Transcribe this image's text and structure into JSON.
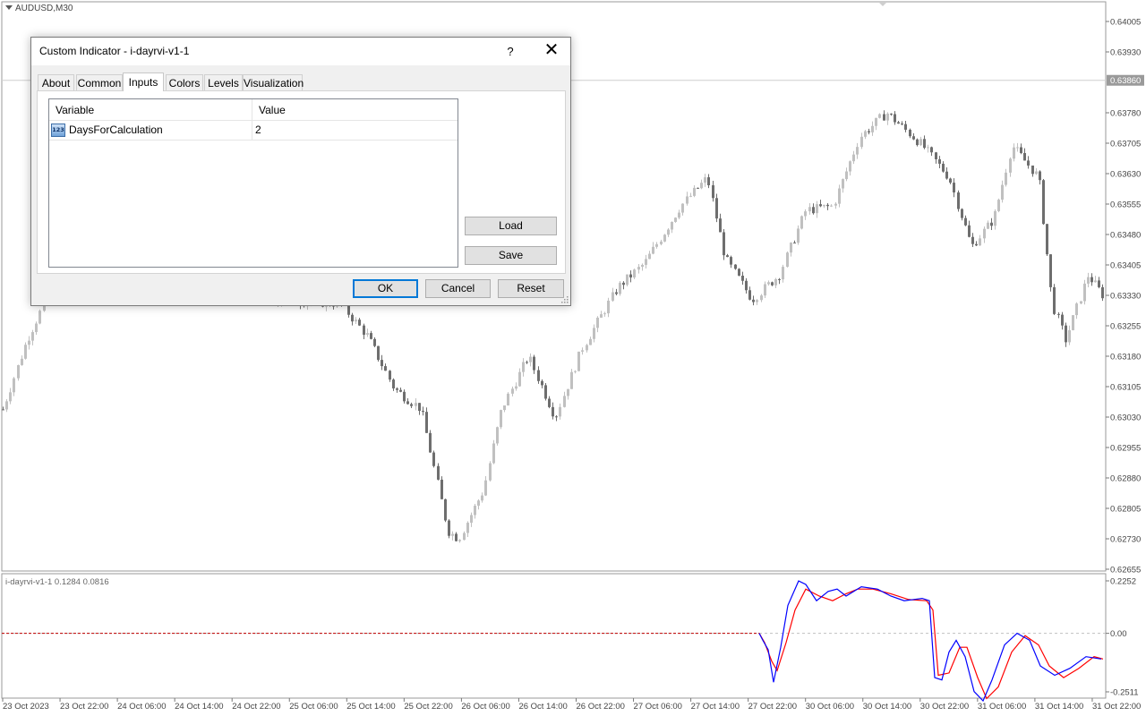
{
  "chart": {
    "symbol": "AUDUSD,M30",
    "current_price": "0.63860",
    "price_ticks": [
      "0.64005",
      "0.63930",
      "0.63780",
      "0.63705",
      "0.63630",
      "0.63555",
      "0.63480",
      "0.63405",
      "0.63330",
      "0.63255",
      "0.63180",
      "0.63105",
      "0.63030",
      "0.62955",
      "0.62880",
      "0.62805",
      "0.62730",
      "0.62655"
    ],
    "time_labels": [
      "23 Oct 2023",
      "23 Oct 22:00",
      "24 Oct 06:00",
      "24 Oct 14:00",
      "24 Oct 22:00",
      "25 Oct 06:00",
      "25 Oct 14:00",
      "25 Oct 22:00",
      "26 Oct 06:00",
      "26 Oct 14:00",
      "26 Oct 22:00",
      "27 Oct 06:00",
      "27 Oct 14:00",
      "27 Oct 22:00",
      "30 Oct 06:00",
      "30 Oct 14:00",
      "30 Oct 22:00",
      "31 Oct 06:00",
      "31 Oct 14:00",
      "31 Oct 22:00"
    ],
    "colors": {
      "bull": "#c0c0c0",
      "bear": "#6e6e6e",
      "line_blue": "#0000ff",
      "line_red": "#ff0000",
      "level": "#c00000"
    }
  },
  "indicator": {
    "label": "i-dayrvi-v1-1 0.1284 0.0816",
    "ticks": [
      "0.2252",
      "0.00",
      "-0.2511"
    ]
  },
  "dialog": {
    "title": "Custom Indicator - i-dayrvi-v1-1",
    "help": "?",
    "close": "✕",
    "tabs": [
      "About",
      "Common",
      "Inputs",
      "Colors",
      "Levels",
      "Visualization"
    ],
    "active_tab": "Inputs",
    "grid": {
      "columns": [
        "Variable",
        "Value"
      ],
      "rows": [
        {
          "icon": "123",
          "variable": "DaysForCalculation",
          "value": "2"
        }
      ]
    },
    "load": "Load",
    "save": "Save",
    "ok": "OK",
    "cancel": "Cancel",
    "reset": "Reset"
  }
}
